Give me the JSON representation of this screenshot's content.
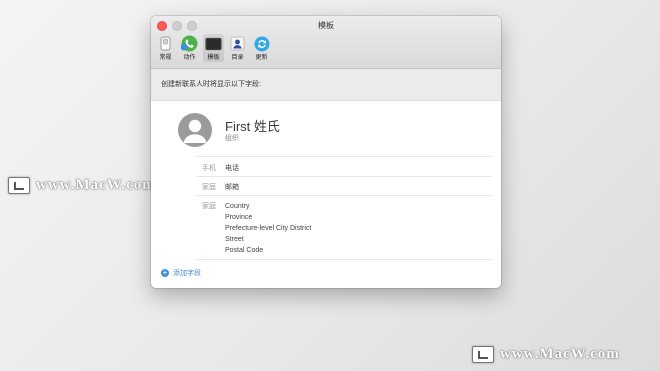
{
  "window": {
    "title": "模板"
  },
  "toolbar": {
    "items": [
      {
        "label": "常规",
        "icon": "switch-icon"
      },
      {
        "label": "动作",
        "icon": "phone-icon"
      },
      {
        "label": "模板",
        "icon": "template-icon"
      },
      {
        "label": "目录",
        "icon": "directory-icon"
      },
      {
        "label": "更新",
        "icon": "sync-icon"
      }
    ]
  },
  "header": {
    "text": "创建新联系人时将显示以下字段:"
  },
  "card": {
    "name": "First 姓氏",
    "org": "组织",
    "rows": [
      {
        "label": "手机",
        "value": "电话"
      },
      {
        "label": "家庭",
        "value": "邮箱"
      },
      {
        "label": "家庭",
        "lines": [
          "Country",
          "Province",
          "Prefecture-level City  District",
          "Street",
          "Postal Code"
        ]
      }
    ]
  },
  "add_field": {
    "label": "添加字段"
  },
  "watermark": {
    "text": "www.MacW.com"
  },
  "colors": {
    "accent": "#3f8fde",
    "close": "#fc5b57"
  }
}
